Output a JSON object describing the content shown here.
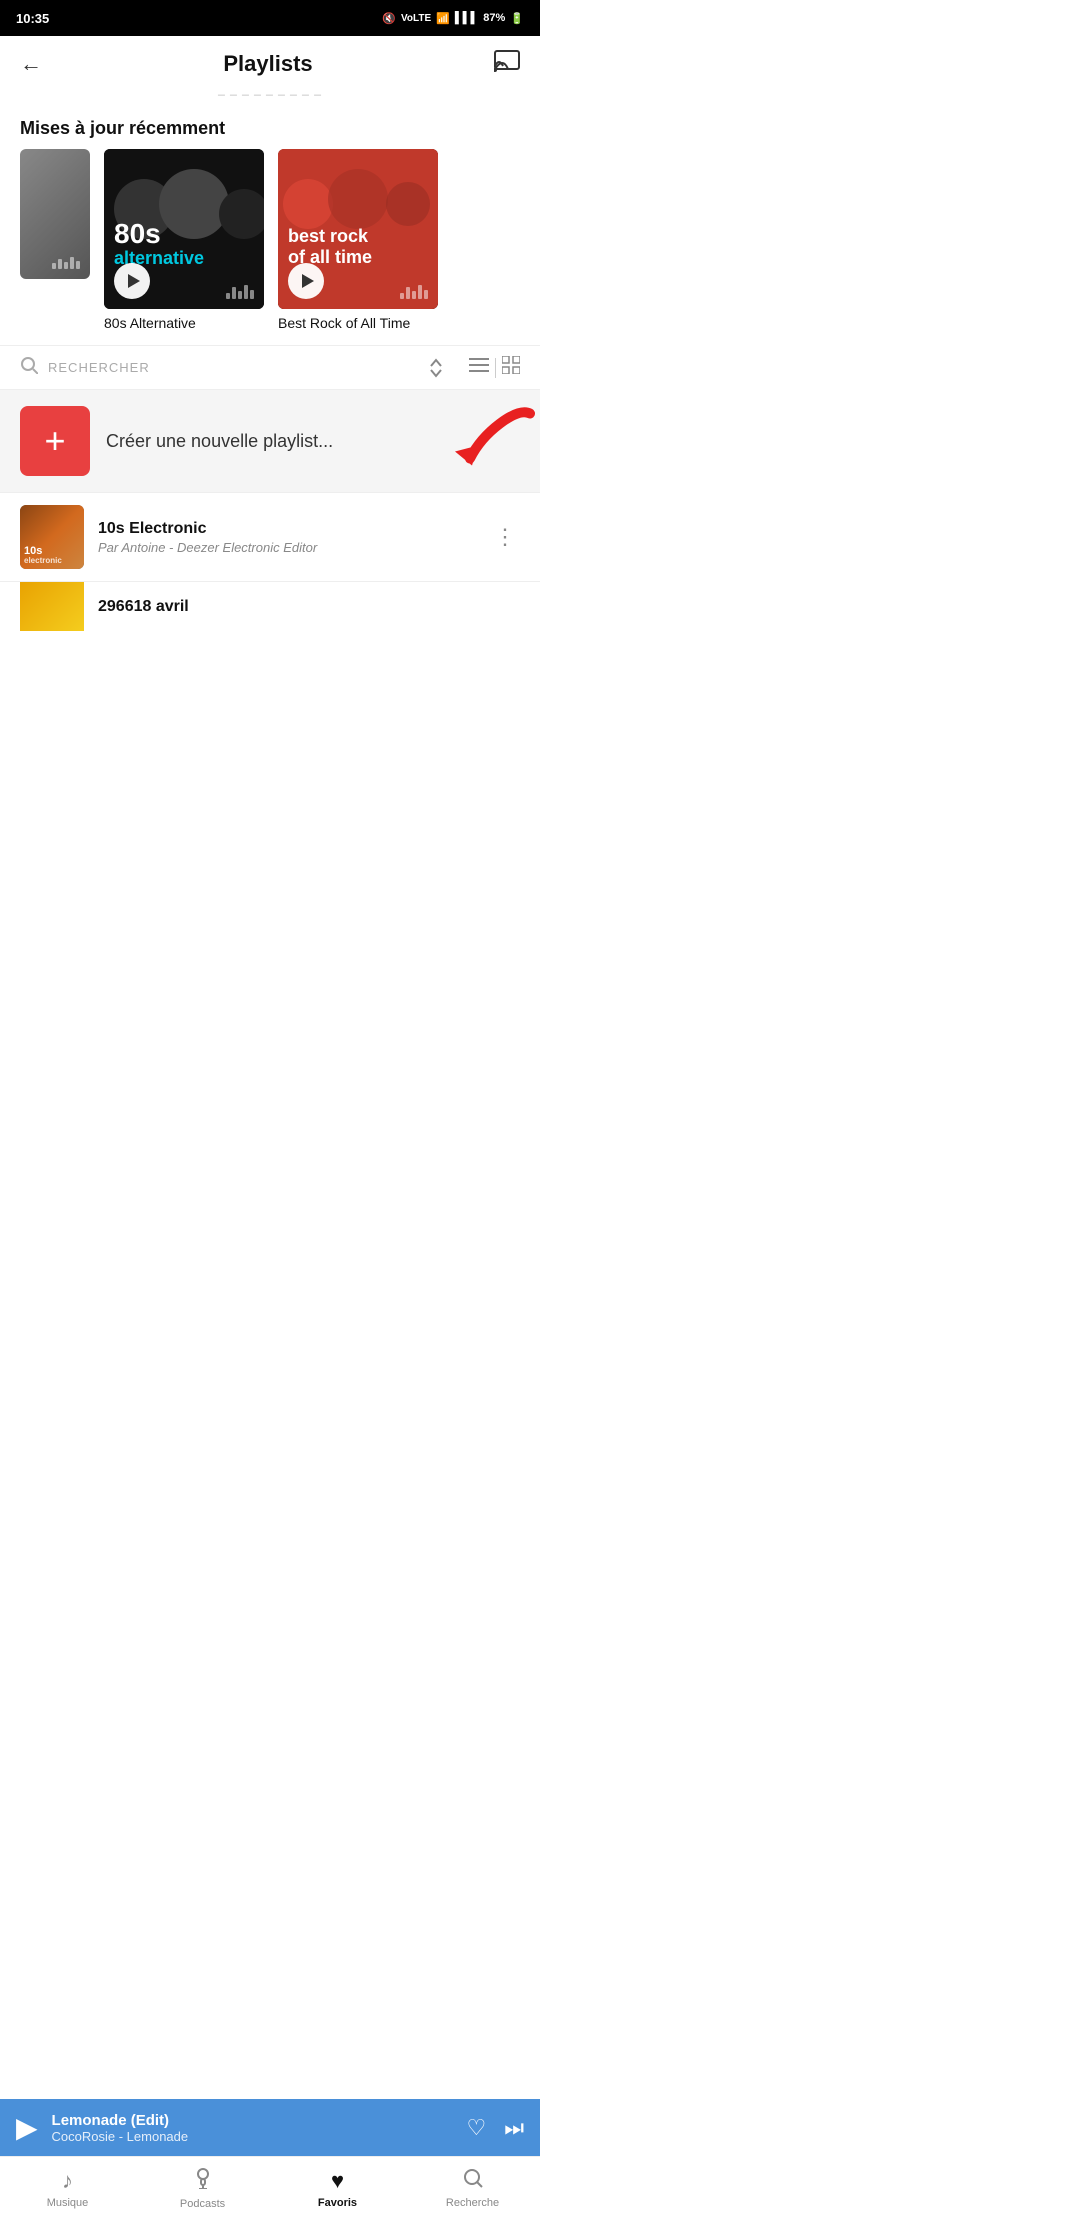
{
  "status": {
    "time": "10:35",
    "battery": "87%",
    "signal_icon": "signal",
    "wifi_icon": "wifi",
    "mute_icon": "mute"
  },
  "header": {
    "back_label": "←",
    "title": "Playlists",
    "subtitle": "_ _ _ _ _ _ _ _ _",
    "cast_icon": "cast"
  },
  "recently_updated": {
    "section_title": "Mises à jour récemment",
    "playlists": [
      {
        "id": "partial",
        "label": ""
      },
      {
        "id": "80s",
        "label": "80s Alternative",
        "overlay_big": "80s",
        "overlay_sub": "alternative"
      },
      {
        "id": "rock",
        "label": "Best Rock of All Time",
        "overlay_text": "best rock\nof all time"
      }
    ]
  },
  "search": {
    "placeholder": "RECHERCHER",
    "sort_icon": "chevrons-up-down",
    "list_view_icon": "list",
    "grid_view_icon": "grid"
  },
  "create_playlist": {
    "btn_label": "+",
    "text": "Créer une nouvelle playlist..."
  },
  "playlist_items": [
    {
      "id": "10s-electronic",
      "name": "10s Electronic",
      "author": "Par Antoine - Deezer Electronic Editor",
      "thumb_label": "10s\nelectronic"
    },
    {
      "id": "second",
      "name": "296618 avril",
      "author": "",
      "thumb_label": ""
    }
  ],
  "mini_player": {
    "play_icon": "▶",
    "title": "Lemonade (Edit)",
    "subtitle": "CocoRosie - Lemonade",
    "heart_icon": "♡",
    "next_icon": "⏭"
  },
  "bottom_nav": {
    "items": [
      {
        "id": "musique",
        "label": "Musique",
        "icon": "♪",
        "active": false
      },
      {
        "id": "podcasts",
        "label": "Podcasts",
        "icon": "🎙",
        "active": false
      },
      {
        "id": "favoris",
        "label": "Favoris",
        "icon": "♥",
        "active": true
      },
      {
        "id": "recherche",
        "label": "Recherche",
        "icon": "🔍",
        "active": false
      }
    ]
  },
  "android_nav": {
    "menu": "|||",
    "home": "○",
    "back": "‹"
  }
}
